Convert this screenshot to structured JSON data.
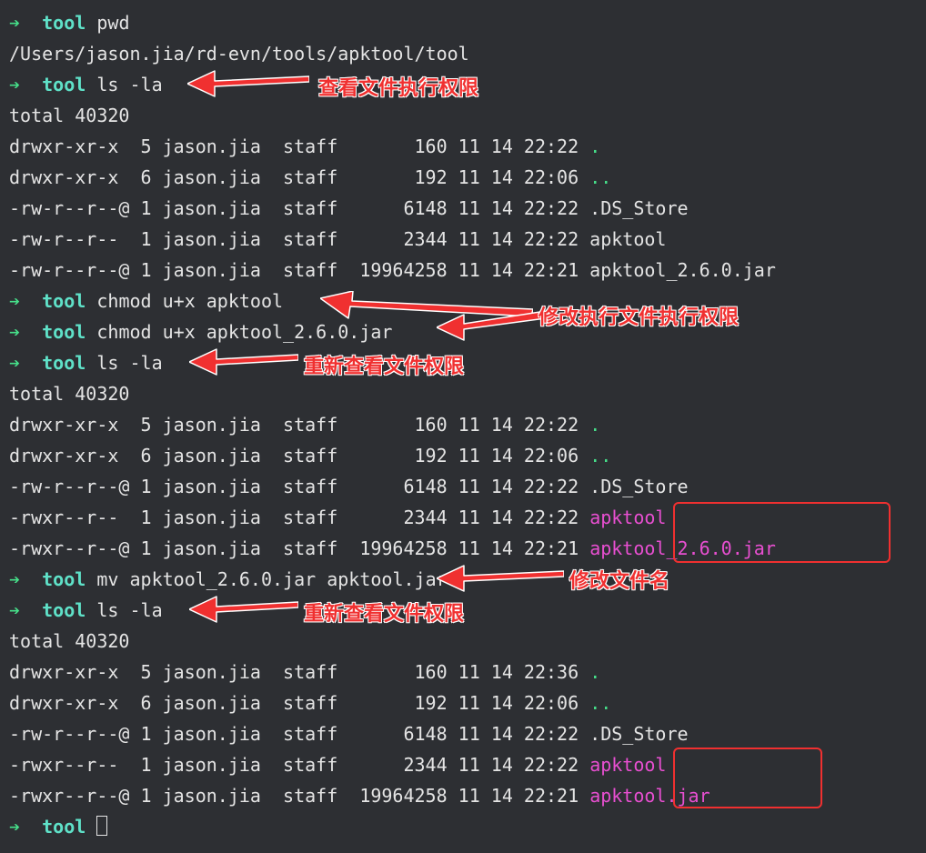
{
  "prompt_arrow": "➔",
  "prompt_name": "tool",
  "commands": {
    "pwd": "pwd",
    "ls_la": "ls -la",
    "chmod_apktool": "chmod u+x apktool",
    "chmod_jar": "chmod u+x apktool_2.6.0.jar",
    "mv": "mv apktool_2.6.0.jar apktool.jar"
  },
  "outputs": {
    "pwd": "/Users/jason.jia/rd-evn/tools/apktool/tool",
    "total": "total 40320"
  },
  "listing1": [
    {
      "perm": "drwxr-xr-x ",
      "n": "5",
      "user": "jason.jia",
      "group": "staff",
      "size": "160",
      "date": "11 14 22:22",
      "name": ".",
      "exec": false,
      "dot": true
    },
    {
      "perm": "drwxr-xr-x ",
      "n": "6",
      "user": "jason.jia",
      "group": "staff",
      "size": "192",
      "date": "11 14 22:06",
      "name": "..",
      "exec": false,
      "dot": true
    },
    {
      "perm": "-rw-r--r--@",
      "n": "1",
      "user": "jason.jia",
      "group": "staff",
      "size": "6148",
      "date": "11 14 22:22",
      "name": ".DS_Store",
      "exec": false,
      "dot": false
    },
    {
      "perm": "-rw-r--r-- ",
      "n": "1",
      "user": "jason.jia",
      "group": "staff",
      "size": "2344",
      "date": "11 14 22:22",
      "name": "apktool",
      "exec": false,
      "dot": false
    },
    {
      "perm": "-rw-r--r--@",
      "n": "1",
      "user": "jason.jia",
      "group": "staff",
      "size": "19964258",
      "date": "11 14 22:21",
      "name": "apktool_2.6.0.jar",
      "exec": false,
      "dot": false
    }
  ],
  "listing2": [
    {
      "perm": "drwxr-xr-x ",
      "n": "5",
      "user": "jason.jia",
      "group": "staff",
      "size": "160",
      "date": "11 14 22:22",
      "name": ".",
      "exec": false,
      "dot": true
    },
    {
      "perm": "drwxr-xr-x ",
      "n": "6",
      "user": "jason.jia",
      "group": "staff",
      "size": "192",
      "date": "11 14 22:06",
      "name": "..",
      "exec": false,
      "dot": true
    },
    {
      "perm": "-rw-r--r--@",
      "n": "1",
      "user": "jason.jia",
      "group": "staff",
      "size": "6148",
      "date": "11 14 22:22",
      "name": ".DS_Store",
      "exec": false,
      "dot": false
    },
    {
      "perm": "-rwxr--r-- ",
      "n": "1",
      "user": "jason.jia",
      "group": "staff",
      "size": "2344",
      "date": "11 14 22:22",
      "name": "apktool",
      "exec": true,
      "dot": false
    },
    {
      "perm": "-rwxr--r--@",
      "n": "1",
      "user": "jason.jia",
      "group": "staff",
      "size": "19964258",
      "date": "11 14 22:21",
      "name": "apktool_2.6.0.jar",
      "exec": true,
      "dot": false
    }
  ],
  "listing3": [
    {
      "perm": "drwxr-xr-x ",
      "n": "5",
      "user": "jason.jia",
      "group": "staff",
      "size": "160",
      "date": "11 14 22:36",
      "name": ".",
      "exec": false,
      "dot": true
    },
    {
      "perm": "drwxr-xr-x ",
      "n": "6",
      "user": "jason.jia",
      "group": "staff",
      "size": "192",
      "date": "11 14 22:06",
      "name": "..",
      "exec": false,
      "dot": true
    },
    {
      "perm": "-rw-r--r--@",
      "n": "1",
      "user": "jason.jia",
      "group": "staff",
      "size": "6148",
      "date": "11 14 22:22",
      "name": ".DS_Store",
      "exec": false,
      "dot": false
    },
    {
      "perm": "-rwxr--r-- ",
      "n": "1",
      "user": "jason.jia",
      "group": "staff",
      "size": "2344",
      "date": "11 14 22:22",
      "name": "apktool",
      "exec": true,
      "dot": false
    },
    {
      "perm": "-rwxr--r--@",
      "n": "1",
      "user": "jason.jia",
      "group": "staff",
      "size": "19964258",
      "date": "11 14 22:21",
      "name": "apktool.jar",
      "exec": true,
      "dot": false
    }
  ],
  "annotations": {
    "a1": "查看文件执行权限",
    "a2": "修改执行文件执行权限",
    "a3": "重新查看文件权限",
    "a4": "修改文件名",
    "a5": "重新查看文件权限"
  }
}
